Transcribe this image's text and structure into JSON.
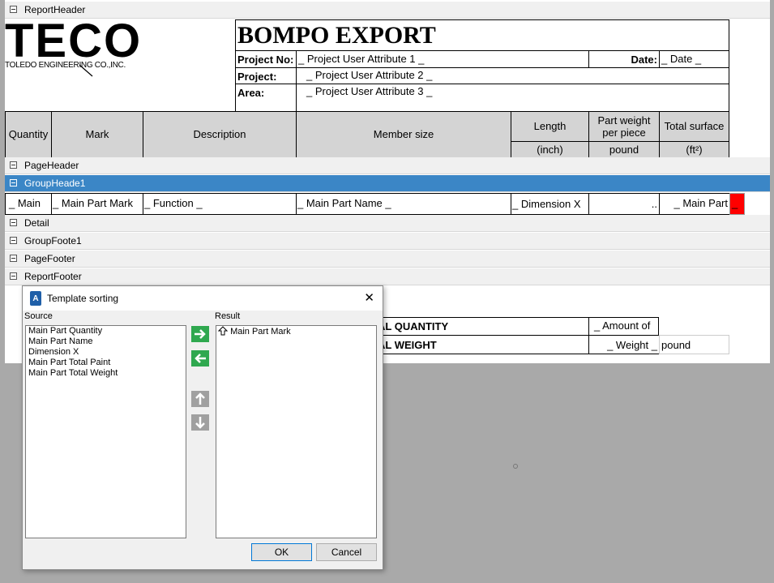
{
  "report_header": {
    "band_label": "ReportHeader",
    "logo_text": "TECO",
    "logo_sub": "TOLEDO ENGINEERING CO.,INC.",
    "title": "BOMPO EXPORT",
    "project_no_label": "Project No:",
    "project_no_value": "_ Project User Attribute 1 _",
    "date_label": "Date:",
    "date_value": "_ Date _",
    "project_label": "Project:",
    "project_value": "_ Project User Attribute 2 _",
    "area_label": "Area:",
    "area_value": "_ Project User Attribute 3 _"
  },
  "columns": {
    "quantity": "Quantity",
    "mark": "Mark",
    "description": "Description",
    "member_size": "Member size",
    "length": "Length",
    "length_unit": "(inch)",
    "part_weight": "Part weight per piece",
    "part_weight_unit": "pound",
    "total_surface": "Total surface",
    "total_surface_unit": "(ft²)"
  },
  "bands": {
    "page_header": "PageHeader",
    "group_header": "GroupHeade1",
    "detail": "Detail",
    "group_footer": "GroupFoote1",
    "page_footer": "PageFooter",
    "report_footer": "ReportFooter"
  },
  "group_row": {
    "main": "_ Main",
    "main_part_mark": "_ Main Part Mark",
    "function": "_ Function _",
    "main_part_name": "_ Main Part Name _",
    "dimension_x": "_ Dimension X",
    "dots": "..",
    "main_part": "_ Main Part",
    "red_cell": "_"
  },
  "footer": {
    "total_quantity": "AL QUANTITY",
    "amount_of": "_ Amount of",
    "total_weight": "AL WEIGHT",
    "weight": "_ Weight _",
    "pound": "pound"
  },
  "dialog": {
    "title": "Template sorting",
    "close": "✕",
    "source_label": "Source",
    "result_label": "Result",
    "source_items": [
      "Main Part Quantity",
      "Main Part Name",
      "Dimension X",
      "Main Part Total Paint",
      "Main Part Total Weight"
    ],
    "result_items": [
      "Main Part Mark"
    ],
    "ok": "OK",
    "cancel": "Cancel",
    "colors": {
      "green": "#2fa84f",
      "gray": "#a0a0a0"
    }
  }
}
